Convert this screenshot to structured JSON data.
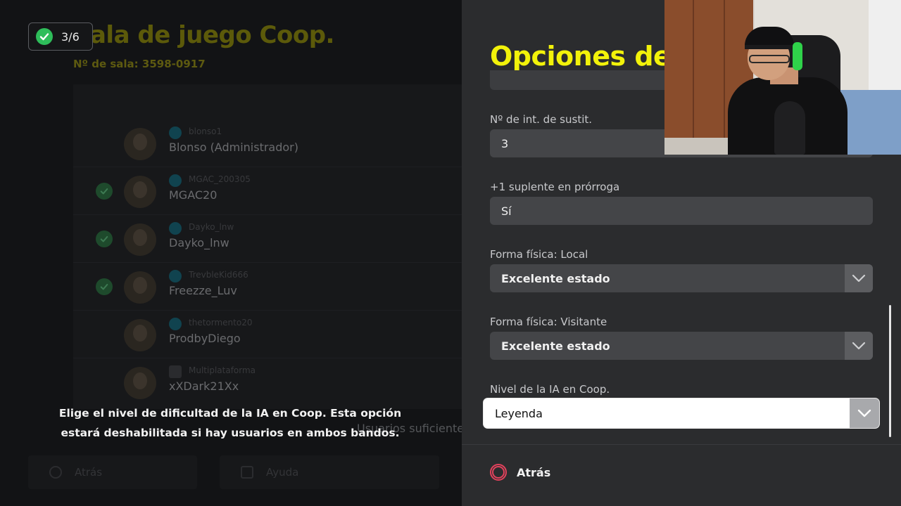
{
  "lobby": {
    "title": "Sala de juego Coop.",
    "room_number": "Nº de sala: 3598-0917",
    "ready_counter": "3/6",
    "players": [
      {
        "id": "blonso1",
        "name": "Blonso (Administrador)",
        "ready": false,
        "platform": "psn"
      },
      {
        "id": "MGAC_200305",
        "name": "MGAC20",
        "ready": true,
        "platform": "psn"
      },
      {
        "id": "Dayko_lnw",
        "name": "Dayko_lnw",
        "ready": true,
        "platform": "psn"
      },
      {
        "id": "TrevbleKid666",
        "name": "Freezze_Luv",
        "ready": true,
        "platform": "psn"
      },
      {
        "id": "thetormento20",
        "name": "ProdbyDiego",
        "ready": false,
        "platform": "psn"
      },
      {
        "id": "Multiplataforma",
        "name": "xXDark21Xx",
        "ready": false,
        "platform": "multi"
      }
    ],
    "status": "Usuarios suficientes",
    "footer": {
      "back_label": "Atrás",
      "help_label": "Ayuda"
    }
  },
  "tip": "Elige el nivel de dificultad de la IA en Coop. Esta opción estará deshabilitada si hay usuarios en ambos bandos.",
  "options": {
    "title": "Opciones de",
    "fields": [
      {
        "label": "Nº de int. de sustit.",
        "value": "3",
        "dropdown": false
      },
      {
        "label": "+1 suplente en prórroga",
        "value": "Sí",
        "dropdown": false
      },
      {
        "label": "Forma física: Local",
        "value": "Excelente estado",
        "dropdown": true
      },
      {
        "label": "Forma física: Visitante",
        "value": "Excelente estado",
        "dropdown": true
      },
      {
        "label": "Nivel de la IA en Coop.",
        "value": "Leyenda",
        "dropdown": true,
        "selected": true
      }
    ],
    "back_label": "Atrás"
  },
  "colors": {
    "title_yellow": "#f2f20a",
    "back_icon_red": "#e2425c",
    "ready_green": "#2ebd5a"
  },
  "icons": {
    "back_button": "circle-button-icon",
    "dropdown": "chevron-down-icon",
    "ready": "check-icon"
  }
}
